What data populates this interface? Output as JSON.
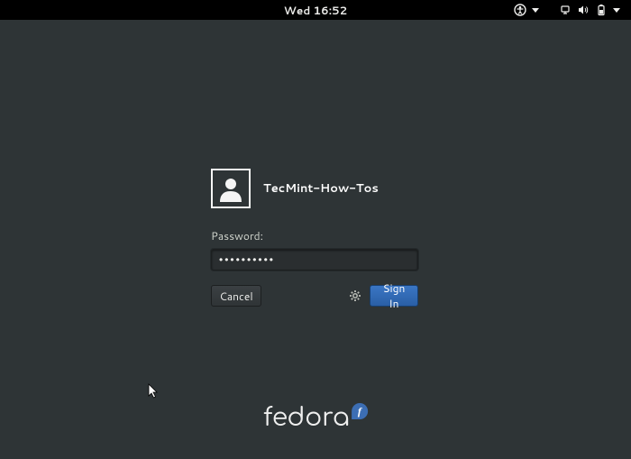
{
  "topbar": {
    "clock": "Wed 16:52"
  },
  "login": {
    "username": "TecMint-How-Tos",
    "password_label": "Password:",
    "password_value": "••••••••••",
    "cancel_label": "Cancel",
    "signin_label": "Sign In"
  },
  "branding": {
    "distro": "fedora",
    "symbol": "f"
  }
}
